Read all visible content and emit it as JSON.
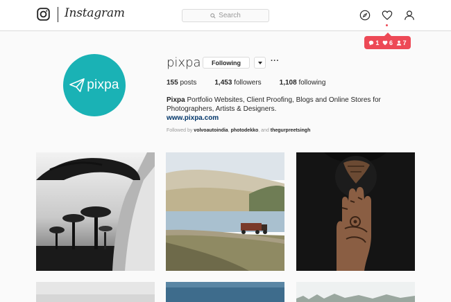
{
  "nav": {
    "wordmark": "Instagram",
    "search_placeholder": "Search",
    "icons": [
      "camera-logo-icon",
      "compass-icon",
      "heart-icon",
      "profile-icon"
    ]
  },
  "notifications": {
    "comments": "1",
    "likes": "6",
    "follows": "7",
    "color": "#ed4956"
  },
  "profile": {
    "avatar_text": "pixpa",
    "avatar_color": "#1ab2b5",
    "username": "pixpa",
    "following_label": "Following",
    "more_label": "···",
    "posts_count": "155",
    "posts_label": "posts",
    "followers_count": "1,453",
    "followers_label": "followers",
    "following_count": "1,108",
    "following_stat_label": "following",
    "bio_name": "Pixpa",
    "bio_text_1": " Portfolio Websites, Client Proofing, Blogs and Online Stores for",
    "bio_text_2": "Photographers, Artists & Designers.",
    "website": "www.pixpa.com",
    "followed_by_prefix": "Followed by ",
    "followed_by_1": "volvoautoindia",
    "followed_by_sep": ", ",
    "followed_by_2": "photodekko",
    "followed_by_and": ", and ",
    "followed_by_3": "thegurpreetsingh"
  },
  "posts": [
    {
      "subject": "black-and-white quiver trees"
    },
    {
      "subject": "truck on a country road by a lake"
    },
    {
      "subject": "veiled woman with hennaed hand"
    },
    {
      "subject": "snowy landscape"
    },
    {
      "subject": "water"
    },
    {
      "subject": "misty treeline"
    }
  ]
}
